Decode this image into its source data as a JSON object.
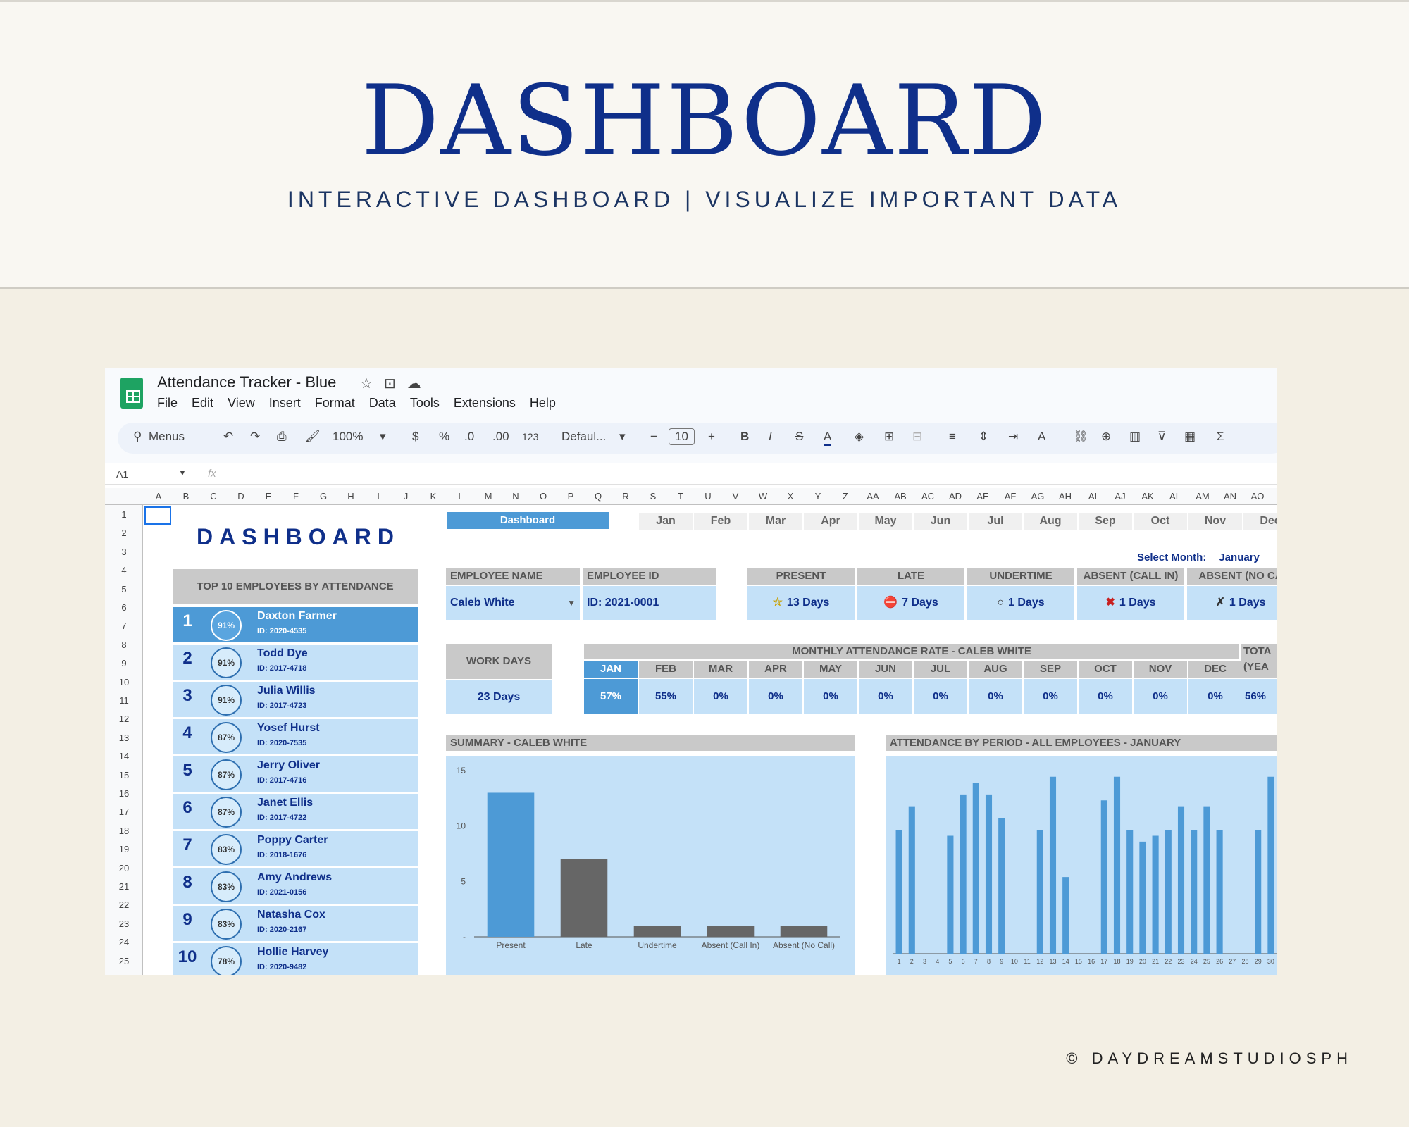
{
  "hero": {
    "title": "DASHBOARD",
    "subtitle": "INTERACTIVE DASHBOARD | VISUALIZE IMPORTANT DATA",
    "copyright": "© DAYDREAMSTUDIOSPH"
  },
  "app": {
    "doc_title": "Attendance Tracker - Blue",
    "menu": [
      "File",
      "Edit",
      "View",
      "Insert",
      "Format",
      "Data",
      "Tools",
      "Extensions",
      "Help"
    ],
    "toolbar": {
      "search": "Menus",
      "zoom": "100%",
      "currency": "$",
      "percent": "%",
      "dec_dec": ".0",
      "dec_inc": ".00",
      "num_fmt": "123",
      "font": "Defaul...",
      "font_size": "10",
      "bold": "B",
      "italic": "I"
    },
    "cell_ref": "A1",
    "fx": "fx"
  },
  "columns": [
    "A",
    "B",
    "C",
    "D",
    "E",
    "F",
    "G",
    "H",
    "I",
    "J",
    "K",
    "L",
    "M",
    "N",
    "O",
    "P",
    "Q",
    "R",
    "S",
    "T",
    "U",
    "V",
    "W",
    "X",
    "Y",
    "Z",
    "AA",
    "AB",
    "AC",
    "AD",
    "AE",
    "AF",
    "AG",
    "AH",
    "AI",
    "AJ",
    "AK",
    "AL",
    "AM",
    "AN",
    "AO"
  ],
  "rows": [
    "1",
    "2",
    "3",
    "4",
    "5",
    "6",
    "7",
    "8",
    "9",
    "10",
    "11",
    "12",
    "13",
    "14",
    "15",
    "16",
    "17",
    "18",
    "19",
    "20",
    "21",
    "22",
    "23",
    "24",
    "25"
  ],
  "sheet": {
    "title": "DASHBOARD",
    "top10_title": "TOP 10 EMPLOYEES BY ATTENDANCE",
    "employees": [
      {
        "rank": "1",
        "pct": "91%",
        "name": "Daxton Farmer",
        "id": "ID: 2020-4535"
      },
      {
        "rank": "2",
        "pct": "91%",
        "name": "Todd Dye",
        "id": "ID: 2017-4718"
      },
      {
        "rank": "3",
        "pct": "91%",
        "name": "Julia Willis",
        "id": "ID: 2017-4723"
      },
      {
        "rank": "4",
        "pct": "87%",
        "name": "Yosef Hurst",
        "id": "ID: 2020-7535"
      },
      {
        "rank": "5",
        "pct": "87%",
        "name": "Jerry Oliver",
        "id": "ID: 2017-4716"
      },
      {
        "rank": "6",
        "pct": "87%",
        "name": "Janet Ellis",
        "id": "ID: 2017-4722"
      },
      {
        "rank": "7",
        "pct": "83%",
        "name": "Poppy Carter",
        "id": "ID: 2018-1676"
      },
      {
        "rank": "8",
        "pct": "83%",
        "name": "Amy Andrews",
        "id": "ID: 2021-0156"
      },
      {
        "rank": "9",
        "pct": "83%",
        "name": "Natasha Cox",
        "id": "ID: 2020-2167"
      },
      {
        "rank": "10",
        "pct": "78%",
        "name": "Hollie Harvey",
        "id": "ID: 2020-9482"
      }
    ],
    "tab_dashboard": "Dashboard",
    "month_tabs": [
      "Jan",
      "Feb",
      "Mar",
      "Apr",
      "May",
      "Jun",
      "Jul",
      "Aug",
      "Sep",
      "Oct",
      "Nov",
      "Dec"
    ],
    "select_month_label": "Select Month:",
    "select_month_value": "January",
    "employee_name_label": "EMPLOYEE NAME",
    "employee_name": "Caleb White",
    "employee_id_label": "EMPLOYEE ID",
    "employee_id": "ID: 2021-0001",
    "stats": [
      {
        "label": "PRESENT",
        "value": "13 Days",
        "icon": "star-icon",
        "glyph": "☆"
      },
      {
        "label": "LATE",
        "value": "7 Days",
        "icon": "no-entry-icon",
        "glyph": "⛔"
      },
      {
        "label": "UNDERTIME",
        "value": "1 Days",
        "icon": "circle-icon",
        "glyph": "○"
      },
      {
        "label": "ABSENT (CALL IN)",
        "value": "1 Days",
        "icon": "cross-icon",
        "glyph": "✖"
      },
      {
        "label": "ABSENT (NO CA",
        "value": "1 Days",
        "icon": "cross-outline-icon",
        "glyph": "✗"
      }
    ],
    "work_days_label": "WORK DAYS",
    "work_days": "23 Days",
    "monthly_rate_title": "MONTHLY ATTENDANCE RATE - CALEB WHITE",
    "monthly_rate_headers": [
      "JAN",
      "FEB",
      "MAR",
      "APR",
      "MAY",
      "JUN",
      "JUL",
      "AUG",
      "SEP",
      "OCT",
      "NOV",
      "DEC"
    ],
    "monthly_rate_values": [
      "57%",
      "55%",
      "0%",
      "0%",
      "0%",
      "0%",
      "0%",
      "0%",
      "0%",
      "0%",
      "0%",
      "0%"
    ],
    "total_label": "TOTA (YEA",
    "total_value": "56%",
    "summary_title": "SUMMARY - CALEB WHITE",
    "period_title": "ATTENDANCE BY PERIOD - ALL EMPLOYEES - JANUARY",
    "colors": {
      "accent": "#4d9ad6",
      "light": "#c4e1f8",
      "navy": "#0f2f8a",
      "gray_bar": "#666666"
    }
  },
  "chart_data": [
    {
      "type": "bar",
      "title": "SUMMARY - CALEB WHITE",
      "categories": [
        "Present",
        "Late",
        "Undertime",
        "Absent (Call In)",
        "Absent (No Call)"
      ],
      "values": [
        13,
        7,
        1,
        1,
        1
      ],
      "ylim": [
        0,
        15
      ],
      "yticks": [
        "15",
        "10",
        "5",
        "-"
      ],
      "colors": [
        "#4d9ad6",
        "#666666",
        "#666666",
        "#666666",
        "#666666"
      ]
    },
    {
      "type": "bar",
      "title": "ATTENDANCE BY PERIOD - ALL EMPLOYEES - JANUARY",
      "categories": [
        "1",
        "2",
        "3",
        "4",
        "5",
        "6",
        "7",
        "8",
        "9",
        "10",
        "11",
        "12",
        "13",
        "14",
        "15",
        "16",
        "17",
        "18",
        "19",
        "20",
        "21",
        "22",
        "23",
        "24",
        "25",
        "26",
        "27",
        "28",
        "29",
        "30"
      ],
      "values": [
        21,
        25,
        0,
        0,
        20,
        27,
        29,
        27,
        23,
        0,
        0,
        21,
        30,
        13,
        0,
        0,
        26,
        30,
        21,
        19,
        20,
        21,
        25,
        21,
        25,
        21,
        0,
        0,
        21,
        30
      ],
      "ylim": [
        0,
        32
      ]
    }
  ]
}
